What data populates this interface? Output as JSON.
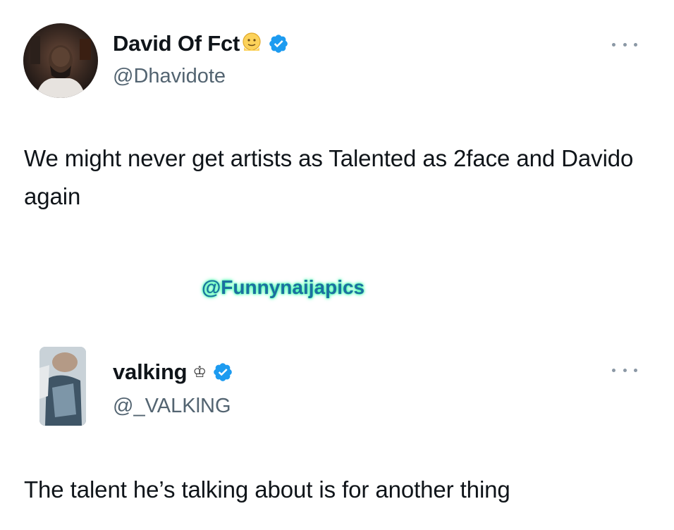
{
  "tweet_1": {
    "display_name": "David Of Fct",
    "name_emoji": "🫠",
    "handle": "@Dhavidote",
    "text": "We might never get artists as Talented as 2face and Davido again",
    "verified": true,
    "avatar": "avatar-photo-man"
  },
  "watermark": {
    "text": "@Funnynaijapics",
    "color": "#1d6fa0",
    "glow": "#39ffa8"
  },
  "tweet_2": {
    "display_name": "valking",
    "name_glyph": "♔",
    "handle": "@_VALKlNG",
    "text": "The talent he’s talking about is for another thing",
    "verified": true,
    "avatar": "avatar-photo-selfie"
  },
  "colors": {
    "verified_badge": "#1d9bf0",
    "handle_text": "#536471",
    "body_text": "#0f1419"
  }
}
